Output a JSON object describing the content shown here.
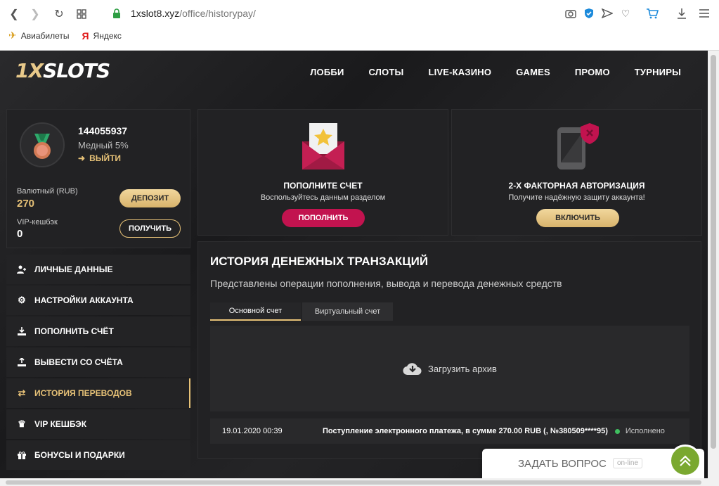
{
  "browser": {
    "url_host": "1xslot8.xyz",
    "url_path": "/office/historypay/",
    "bookmarks": [
      {
        "label": "Авиабилеты",
        "icon": "plane-icon"
      },
      {
        "label": "Яндекс",
        "icon": "yandex-icon"
      }
    ]
  },
  "site": {
    "logo_a": "1X",
    "logo_b": "SLOTS",
    "nav": [
      "ЛОББИ",
      "СЛОТЫ",
      "LIVE-КАЗИНО",
      "GAMES",
      "ПРОМО",
      "ТУРНИРЫ"
    ]
  },
  "profile": {
    "user_id": "144055937",
    "rank": "Медный 5%",
    "logout": "ВЫЙТИ",
    "balance_label": "Валютный (RUB)",
    "balance_value": "270",
    "deposit_button": "ДЕПОЗИТ",
    "vip_label": "VIP-кешбэк",
    "vip_value": "0",
    "get_button": "ПОЛУЧИТЬ"
  },
  "menu": [
    {
      "label": "ЛИЧНЫЕ ДАННЫЕ",
      "icon": "user-plus-icon",
      "name": "personal-data"
    },
    {
      "label": "НАСТРОЙКИ АККАУНТА",
      "icon": "gears-icon",
      "name": "account-settings"
    },
    {
      "label": "ПОПОЛНИТЬ СЧЁТ",
      "icon": "download-icon",
      "name": "deposit"
    },
    {
      "label": "ВЫВЕСТИ СО СЧЁТА",
      "icon": "upload-icon",
      "name": "withdraw"
    },
    {
      "label": "ИСТОРИЯ ПЕРЕВОДОВ",
      "icon": "transfer-icon",
      "name": "history",
      "active": true
    },
    {
      "label": "VIP КЕШБЭК",
      "icon": "crown-icon",
      "name": "vip-cashback"
    },
    {
      "label": "БОНУСЫ И ПОДАРКИ",
      "icon": "gift-icon",
      "name": "bonuses"
    }
  ],
  "cards": {
    "deposit": {
      "title": "ПОПОЛНИТЕ СЧЕТ",
      "subtitle": "Воспользуйтесь данным разделом",
      "button": "ПОПОЛНИТЬ",
      "button_color": "#c2134f"
    },
    "twofa": {
      "title": "2-Х ФАКТОРНАЯ АВТОРИЗАЦИЯ",
      "subtitle": "Получите надёжную защиту аккаунта!",
      "button": "ВКЛЮЧИТЬ"
    }
  },
  "history": {
    "title": "ИСТОРИЯ ДЕНЕЖНЫХ ТРАНЗАКЦИЙ",
    "subtitle": "Представлены операции пополнения, вывода и перевода денежных средств",
    "tabs": [
      "Основной счет",
      "Виртуальный счет"
    ],
    "archive_label": "Загрузить архив",
    "rows": [
      {
        "datetime": "19.01.2020 00:39",
        "description": "Поступление электронного платежа, в сумме 270.00 RUB (, №380509****95)",
        "status": "Исполнено"
      }
    ]
  },
  "chat": {
    "label": "ЗАДАТЬ ВОПРОС",
    "status": "on-line"
  },
  "colors": {
    "accent_gold": "#e6c177",
    "deposit_pink": "#c2134f",
    "status_green": "#3fbf5f",
    "chat_green": "#7aa830"
  }
}
